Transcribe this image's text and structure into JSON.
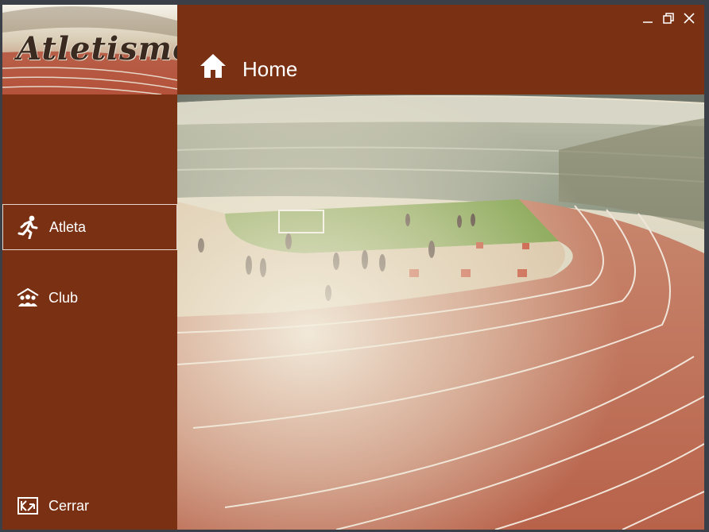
{
  "logo": {
    "text": "Atletismo"
  },
  "sidebar": {
    "items": [
      {
        "label": "Atleta",
        "icon": "runner-icon",
        "active": true
      },
      {
        "label": "Club",
        "icon": "group-icon",
        "active": false
      }
    ],
    "exit": {
      "label": "Cerrar",
      "icon": "exit-icon"
    }
  },
  "header": {
    "title": "Home",
    "icon": "home-icon"
  },
  "window_controls": [
    "minimize-icon",
    "restore-icon",
    "close-icon"
  ],
  "colors": {
    "brand": "#7a3012",
    "text": "#ffffff",
    "active_border": "#e9d6cc"
  }
}
